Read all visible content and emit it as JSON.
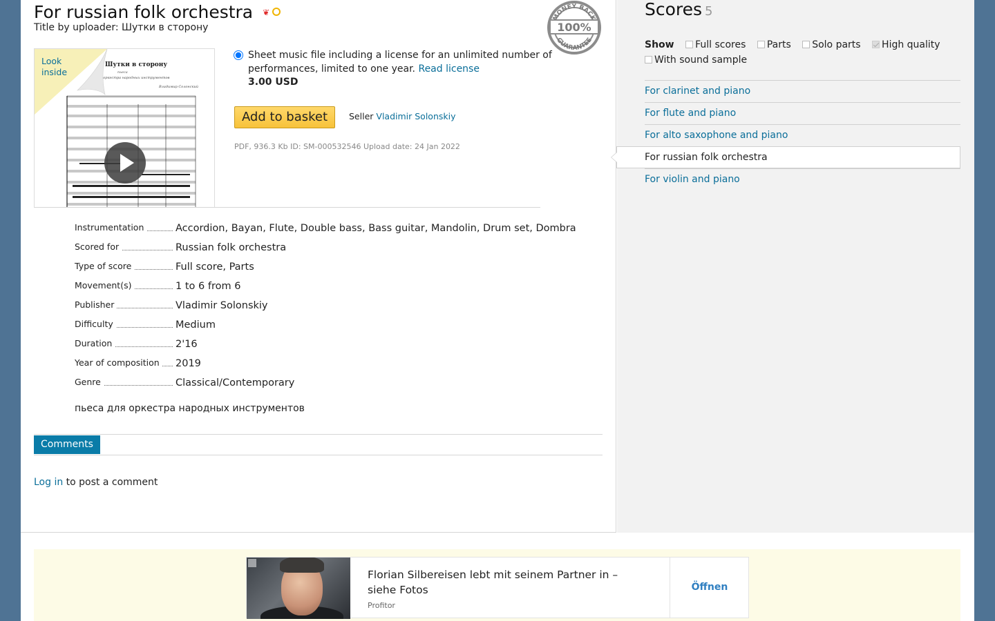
{
  "product": {
    "title": "For russian folk orchestra",
    "uploader_title": "Title by uploader: Шутки в сторону",
    "badges": [
      "award-icon",
      "star-badge-icon"
    ],
    "guarantee": {
      "top": "MONEY BACK",
      "center": "100%",
      "bottom": "GUARANTEE"
    }
  },
  "preview": {
    "look_inside": [
      "Look",
      "inside"
    ],
    "sheet_title": "Шутки в сторону",
    "sheet_subtitle": "пьеса",
    "sheet_subtitle2": "для оркестра народных инструментов",
    "sheet_composer": "Владимир Солонский"
  },
  "license": {
    "text": "Sheet music file including a license for an unlimited number of performances, limited to one year.",
    "link": "Read license",
    "price": "3.00 USD",
    "selected": true
  },
  "basket_label": "Add to basket",
  "seller": {
    "label": "Seller",
    "name": "Vladimir Solonskiy"
  },
  "file_info": "PDF, 936.3 Kb ID: SM-000532546 Upload date: 24 Jan 2022",
  "details": [
    {
      "label": "Instrumentation",
      "value": "Accordion, Bayan, Flute, Double bass, Bass guitar, Mandolin, Drum set, Dombra"
    },
    {
      "label": "Scored for",
      "value": "Russian folk orchestra"
    },
    {
      "label": "Type of score",
      "value": "Full score, Parts"
    },
    {
      "label": "Movement(s)",
      "value": "1 to 6 from 6"
    },
    {
      "label": "Publisher",
      "value": "Vladimir Solonskiy"
    },
    {
      "label": "Difficulty",
      "value": "Medium"
    },
    {
      "label": "Duration",
      "value": "2'16"
    },
    {
      "label": "Year of composition",
      "value": "2019"
    },
    {
      "label": "Genre",
      "value": "Classical/Contemporary"
    }
  ],
  "description": "пьеса для оркестра народных инструментов",
  "comments": {
    "tab": "Comments",
    "login_link": "Log in",
    "login_text": " to post a comment"
  },
  "sidebar": {
    "title": "Scores",
    "count": "5",
    "show_label": "Show",
    "filters": [
      {
        "label": "Full scores",
        "checked": false
      },
      {
        "label": "Parts",
        "checked": false
      },
      {
        "label": "Solo parts",
        "checked": false
      },
      {
        "label": "High quality",
        "checked": true
      },
      {
        "label": "With sound sample",
        "checked": false
      }
    ],
    "scores": [
      {
        "label": "For clarinet and piano",
        "active": false
      },
      {
        "label": "For flute and piano",
        "active": false
      },
      {
        "label": "For alto saxophone and piano",
        "active": false
      },
      {
        "label": "For russian folk orchestra",
        "active": true
      },
      {
        "label": "For violin and piano",
        "active": false
      }
    ]
  },
  "ad": {
    "headline": "Florian Silbereisen lebt mit seinem Partner in – siehe Fotos",
    "source": "Profitor",
    "cta": "Öffnen"
  },
  "colors": {
    "background": "#4f7394",
    "link": "#0a6e99",
    "comments_tab": "#0a7ca8",
    "basket_button": "#f7c23a",
    "sidebar_bg": "#f2f2f2",
    "ad_bg": "#fdfbe6"
  }
}
